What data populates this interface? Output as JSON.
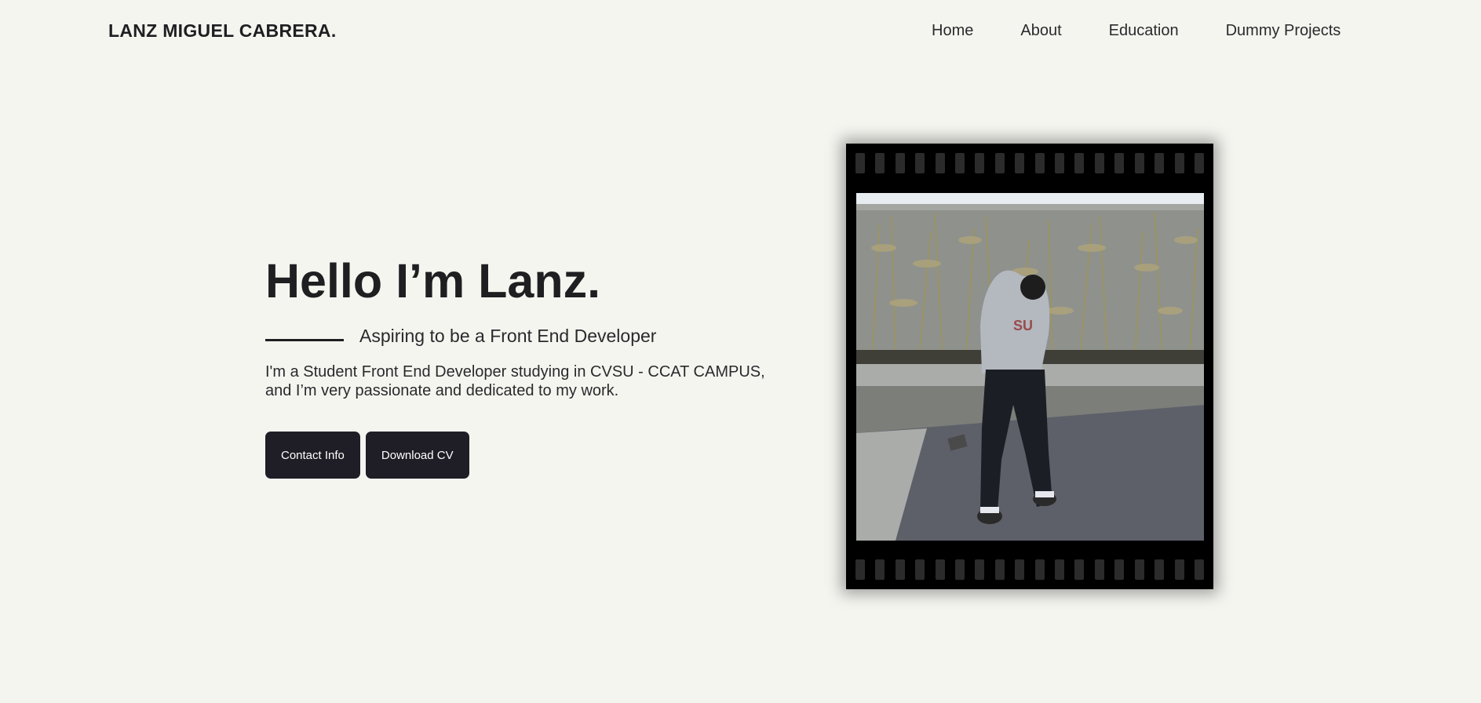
{
  "navbar": {
    "brand": "LANZ MIGUEL CABRERA.",
    "links": [
      {
        "label": "Home"
      },
      {
        "label": "About"
      },
      {
        "label": "Education"
      },
      {
        "label": "Dummy Projects"
      }
    ]
  },
  "hero": {
    "title": "Hello I’m Lanz.",
    "subtitle": "Aspiring to be a Front End Developer",
    "description_line1": "I'm a Student Front End Developer studying in CVSU - CCAT CAMPUS,",
    "description_line2": "and I’m very passionate and dedicated to my work.",
    "buttons": {
      "contact": "Contact Info",
      "download": "Download CV"
    }
  },
  "colors": {
    "background": "#f5f5f0",
    "text": "#1f1f22",
    "button": "#1f1e26",
    "film": "#000000"
  },
  "photo": {
    "icon": "person-photo"
  }
}
